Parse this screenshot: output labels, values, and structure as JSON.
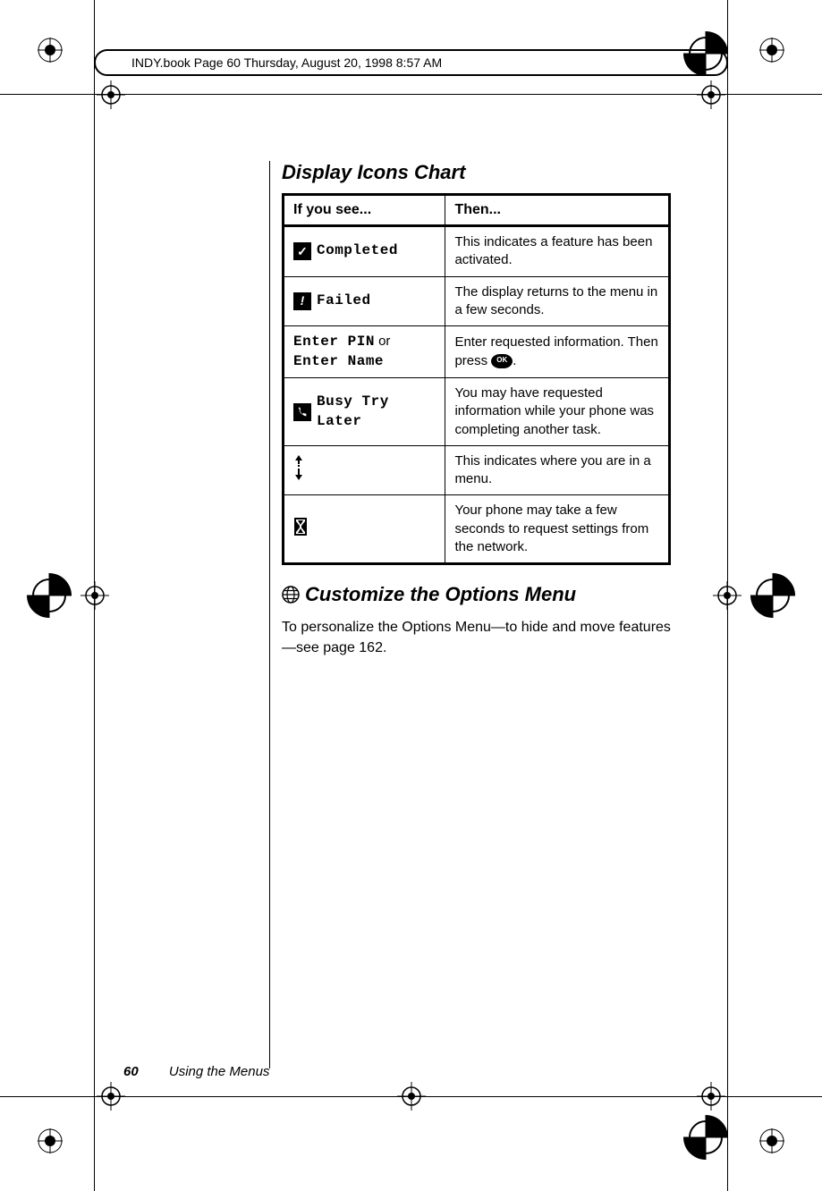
{
  "header": "INDY.book  Page 60  Thursday, August 20, 1998  8:57 AM",
  "section1_heading": "Display Icons Chart",
  "table": {
    "header_left": "If you see...",
    "header_right": "Then...",
    "rows": [
      {
        "left_label": "Completed",
        "right": "This indicates a feature has been activated."
      },
      {
        "left_label": "Failed",
        "right": "The display returns to the menu in a few seconds."
      },
      {
        "left_prefix": "Enter PIN",
        "left_middle": " or ",
        "left_suffix": "Enter Name",
        "right_prefix": "Enter requested information. Then press ",
        "right_suffix": "."
      },
      {
        "left_label": "Busy Try Later",
        "right": "You may have requested information while your phone was completing another task."
      },
      {
        "right": "This indicates where you are in a menu."
      },
      {
        "right": "Your phone may take a few seconds to request settings from the network."
      }
    ]
  },
  "section2_heading": "Customize the Options Menu",
  "body_text": "To personalize the Options Menu—to hide and move features—see page 162.",
  "footer_page": "60",
  "footer_title": "Using the Menus",
  "ok_label": "OK"
}
